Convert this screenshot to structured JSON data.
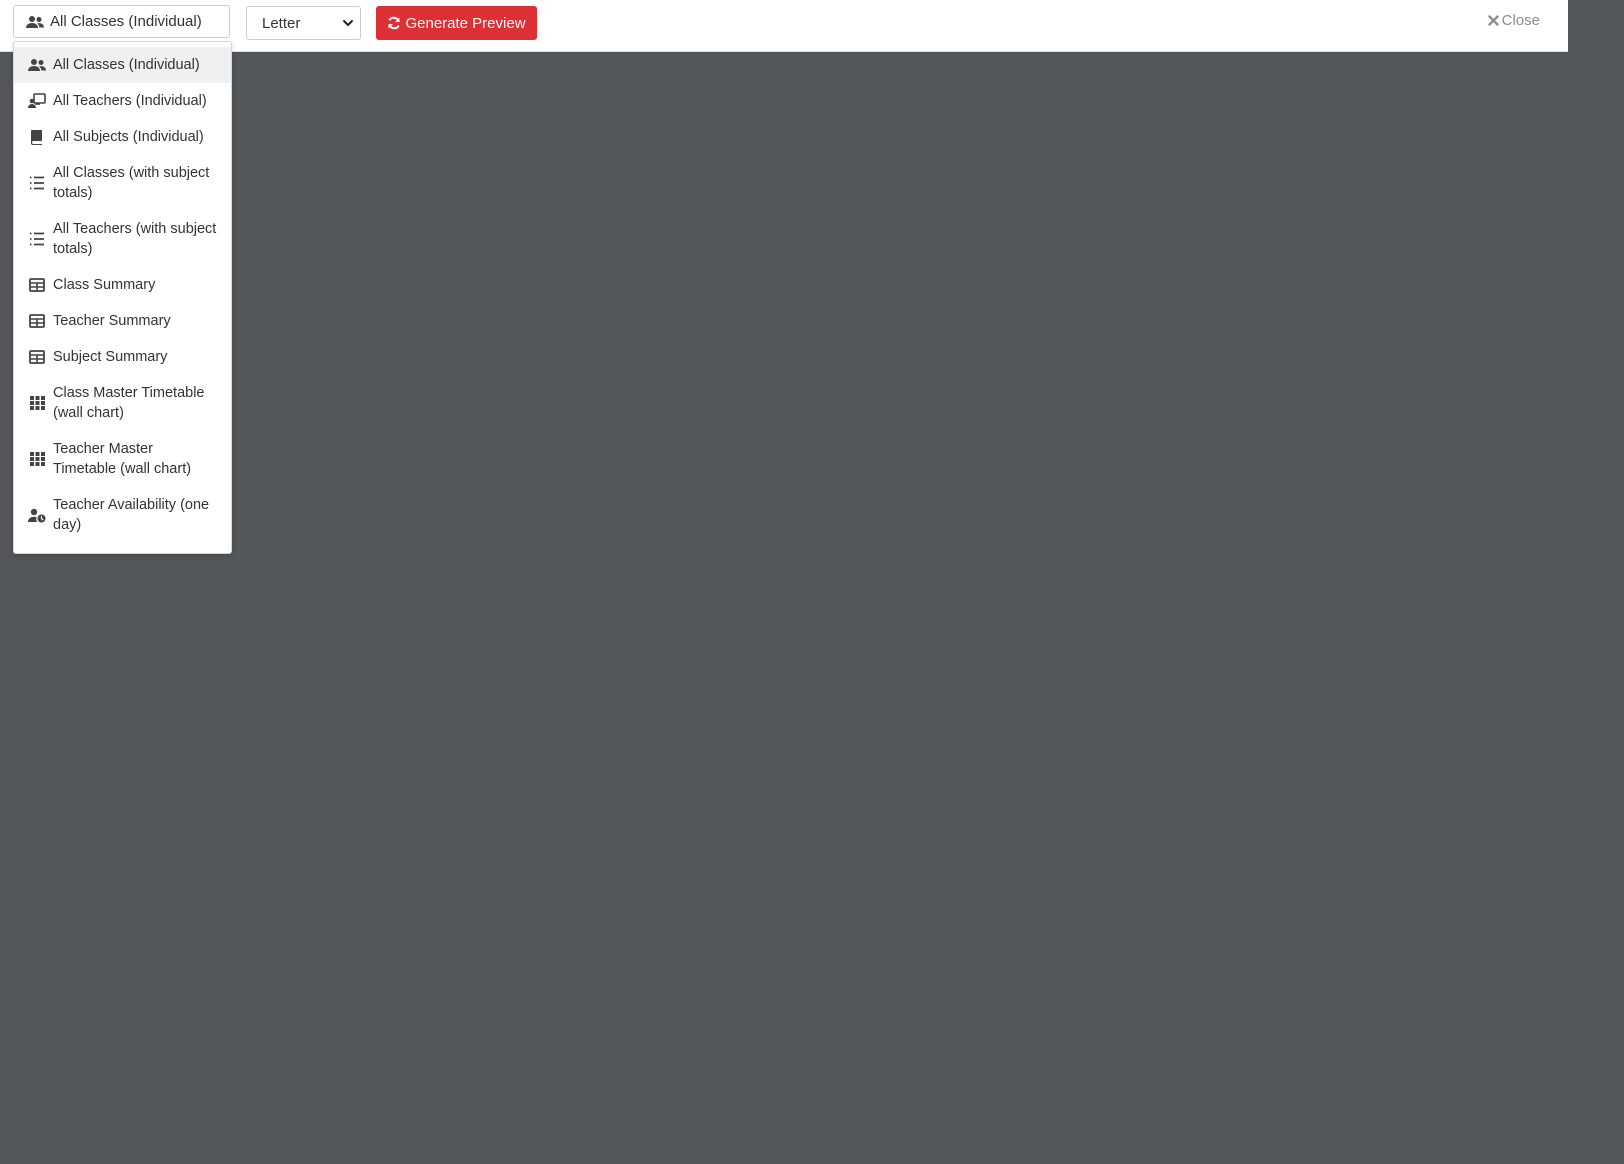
{
  "toolbar": {
    "report_select": {
      "value": "All Classes (Individual)",
      "icon": "users-icon"
    },
    "paper_select": {
      "value": "Letter"
    },
    "generate_button": {
      "label": "Generate Preview",
      "icon": "refresh-icon",
      "color": "#dc3035"
    },
    "close_button": {
      "label": "Close",
      "icon": "close-icon"
    }
  },
  "report_menu": {
    "items": [
      {
        "label": "All Classes (Individual)",
        "icon": "users-icon",
        "active": true
      },
      {
        "label": "All Teachers (Individual)",
        "icon": "chalkboard-teacher-icon"
      },
      {
        "label": "All Subjects (Individual)",
        "icon": "book-icon"
      },
      {
        "label": "All Classes (with subject totals)",
        "icon": "list-icon"
      },
      {
        "label": "All Teachers (with subject totals)",
        "icon": "list-icon"
      },
      {
        "label": "Class Summary",
        "icon": "table-icon"
      },
      {
        "label": "Teacher Summary",
        "icon": "table-icon"
      },
      {
        "label": "Subject Summary",
        "icon": "table-icon"
      },
      {
        "label": "Class Master Timetable (wall chart)",
        "icon": "grid-icon"
      },
      {
        "label": "Teacher Master Timetable (wall chart)",
        "icon": "grid-icon"
      },
      {
        "label": "Teacher Availability (one day)",
        "icon": "user-clock-icon"
      }
    ]
  },
  "colors": {
    "backdrop": "#53575a",
    "accent": "#dc3035"
  }
}
